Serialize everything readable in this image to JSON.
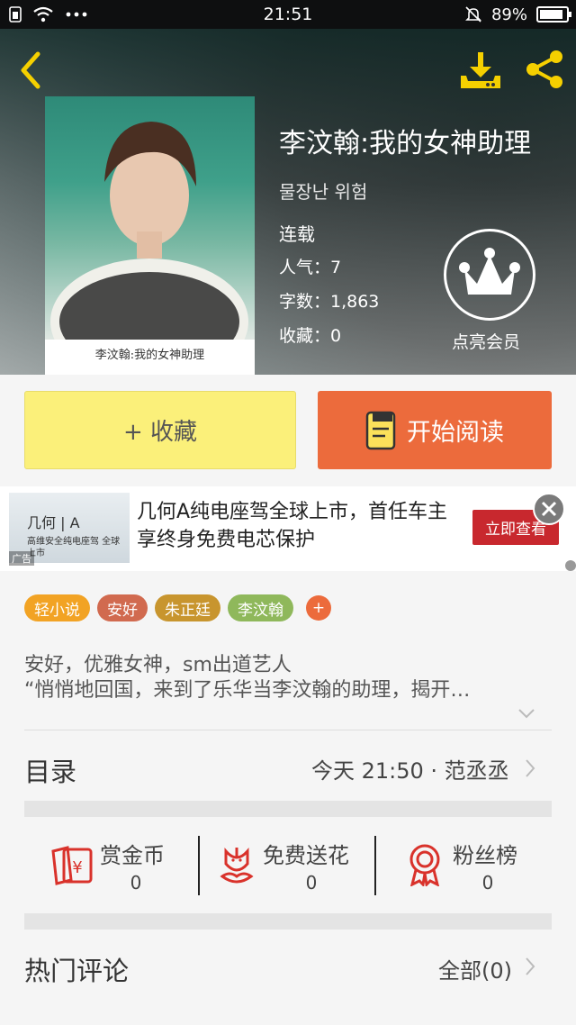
{
  "status_bar": {
    "time": "21:51",
    "battery": "89%",
    "battery_level": 0.89,
    "icons": [
      "sim-icon",
      "wifi-icon",
      "more-dots-icon",
      "mute-bell-icon",
      "battery-icon"
    ]
  },
  "book": {
    "title": "李汶翰:我的女神助理",
    "author": "물장난 위험",
    "status": "连载",
    "popularity": "人气：7",
    "word_count": "字数：1,863",
    "favorites": "收藏：0",
    "cover_title": "李汶翰:我的女神助理",
    "vip_label": "点亮会员"
  },
  "buttons": {
    "favorite": "+ 收藏",
    "read": "开始阅读"
  },
  "ad": {
    "headline": "几何A纯电座驾全球上市，首任车主享终身免费电芯保护",
    "cta": "立即查看",
    "tag": "广告",
    "image_logo": "几何 | A",
    "image_sub": "高维安全纯电座驾 全球上市"
  },
  "tags": [
    {
      "label": "轻小说",
      "color": "#f2a324"
    },
    {
      "label": "安好",
      "color": "#d16a4f"
    },
    {
      "label": "朱正廷",
      "color": "#c8952e"
    },
    {
      "label": "李汶翰",
      "color": "#8fb85b"
    }
  ],
  "tag_more": "+",
  "intro": {
    "line1": "安好，优雅女神，sm出道艺人",
    "line2": "“悄悄地回国，来到了乐华当李汶翰的助理，揭开…"
  },
  "toc": {
    "label": "目录",
    "update": "今天 21:50 · 范丞丞"
  },
  "actions": [
    {
      "label": "赏金币",
      "count": "0",
      "icon": "reward-coin-icon"
    },
    {
      "label": "免费送花",
      "count": "0",
      "icon": "flower-icon"
    },
    {
      "label": "粉丝榜",
      "count": "0",
      "icon": "medal-icon"
    }
  ],
  "comments": {
    "label": "热门评论",
    "all": "全部(0)"
  },
  "colors": {
    "accent_orange": "#ec6b3c",
    "favorite_yellow": "#fbf07a",
    "icon_red": "#d9322b",
    "header_icon_yellow": "#f5d000"
  }
}
